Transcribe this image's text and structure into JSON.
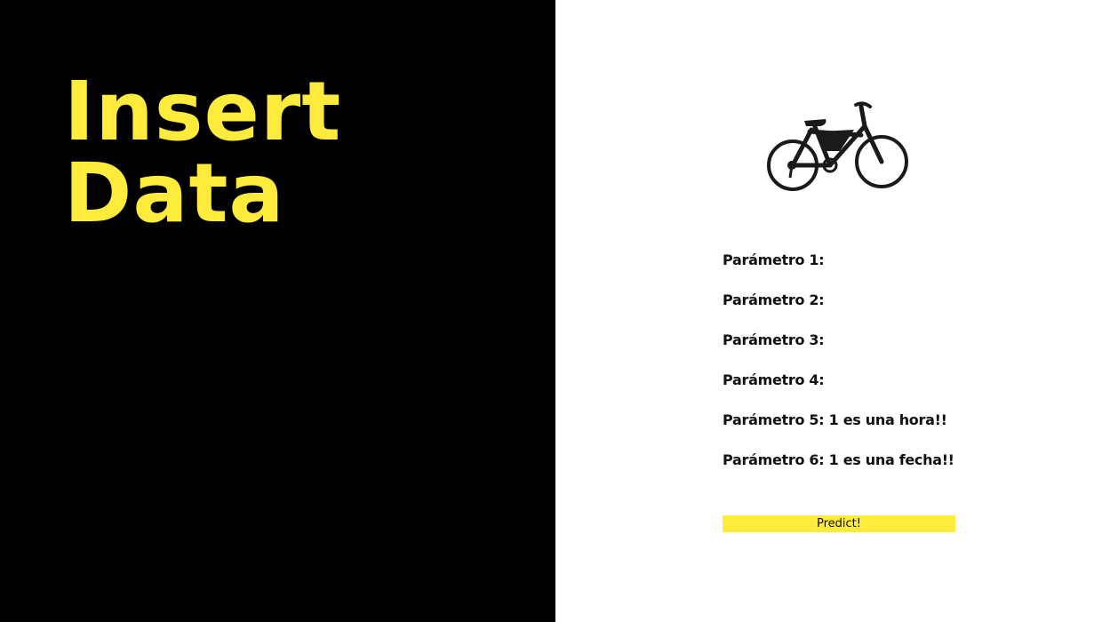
{
  "hero": {
    "title_line1": "Insert",
    "title_line2": "Data"
  },
  "form": {
    "params": [
      "Parámetro 1:",
      "Parámetro 2:",
      "Parámetro 3:",
      "Parámetro 4:",
      "Parámetro 5: 1 es una hora!!",
      "Parámetro 6: 1 es una fecha!!"
    ],
    "submit_label": "Predict!"
  },
  "icons": {
    "illustration": "bicycle-icon"
  },
  "colors": {
    "accent": "#ffeb3b",
    "left_background": "#000000",
    "right_background": "#ffffff"
  }
}
